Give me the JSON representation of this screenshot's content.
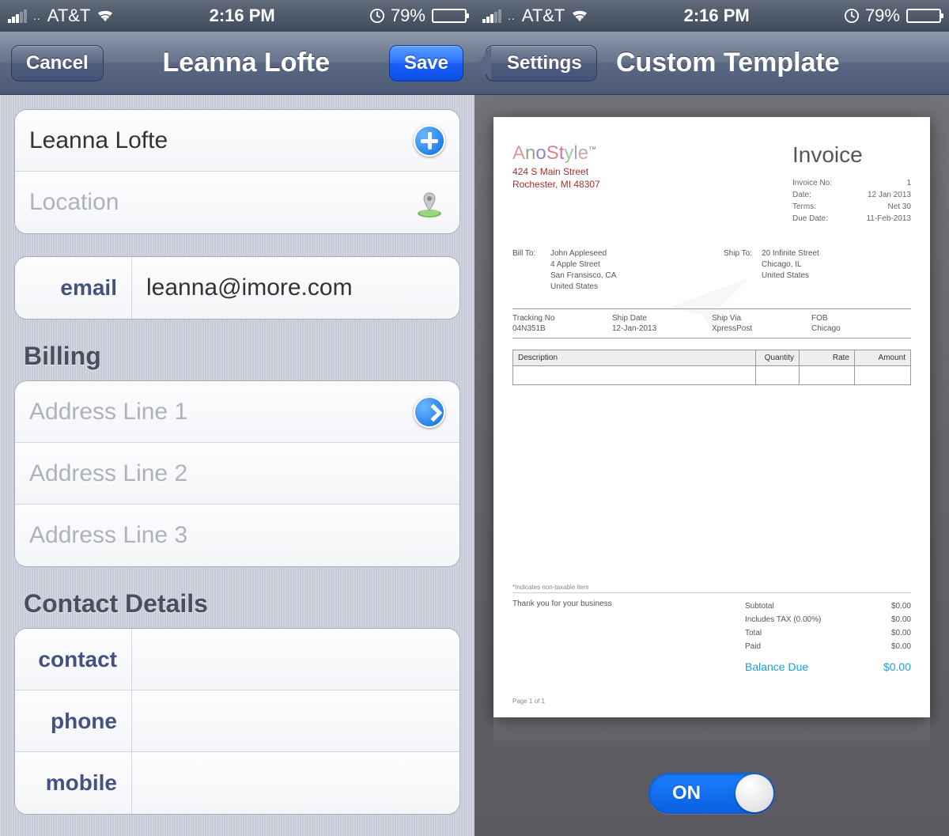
{
  "status": {
    "carrier": "AT&T",
    "time": "2:16 PM",
    "battery": "79%"
  },
  "left": {
    "nav": {
      "cancel": "Cancel",
      "title": "Leanna Lofte",
      "save": "Save"
    },
    "name_value": "Leanna Lofte",
    "location_placeholder": "Location",
    "email_label": "email",
    "email_value": "leanna@imore.com",
    "billing_header": "Billing",
    "addr1": "Address Line 1",
    "addr2": "Address Line 2",
    "addr3": "Address Line 3",
    "contact_header": "Contact Details",
    "contact_label": "contact",
    "phone_label": "phone",
    "mobile_label": "mobile"
  },
  "right": {
    "nav": {
      "back": "Settings",
      "title": "Custom Template"
    },
    "invoice": {
      "brand": "AnoStyle",
      "addr1": "424 S Main Street",
      "addr2": "Rochester, MI 48307",
      "title": "Invoice",
      "meta": {
        "invoice_no_label": "Invoice No:",
        "invoice_no": "1",
        "date_label": "Date:",
        "date": "12 Jan 2013",
        "terms_label": "Terms:",
        "terms": "Net 30",
        "due_label": "Due Date:",
        "due": "11-Feb-2013"
      },
      "bill_to_label": "Bill To:",
      "bill_to": [
        "John Appleseed",
        "4 Apple Street",
        "San Fransisco, CA",
        "United States"
      ],
      "ship_to_label": "Ship To:",
      "ship_to": [
        "20 Infinite Street",
        "Chicago, IL",
        "United States"
      ],
      "shipping": {
        "tracking_label": "Tracking No",
        "tracking": "04N351B",
        "ship_date_label": "Ship Date",
        "ship_date": "12-Jan-2013",
        "ship_via_label": "Ship Via",
        "ship_via": "XpressPost",
        "fob_label": "FOB",
        "fob": "Chicago"
      },
      "cols": {
        "desc": "Description",
        "qty": "Quantity",
        "rate": "Rate",
        "amt": "Amount"
      },
      "note": "*Indicates non-taxable item",
      "thanks": "Thank you for your business",
      "totals": {
        "subtotal_label": "Subtotal",
        "subtotal": "$0.00",
        "tax_label": "Includes TAX (0.00%)",
        "tax": "$0.00",
        "total_label": "Total",
        "total": "$0.00",
        "paid_label": "Paid",
        "paid": "$0.00",
        "balance_label": "Balance Due",
        "balance": "$0.00"
      },
      "page": "Page 1 of 1"
    },
    "toggle": "ON"
  }
}
